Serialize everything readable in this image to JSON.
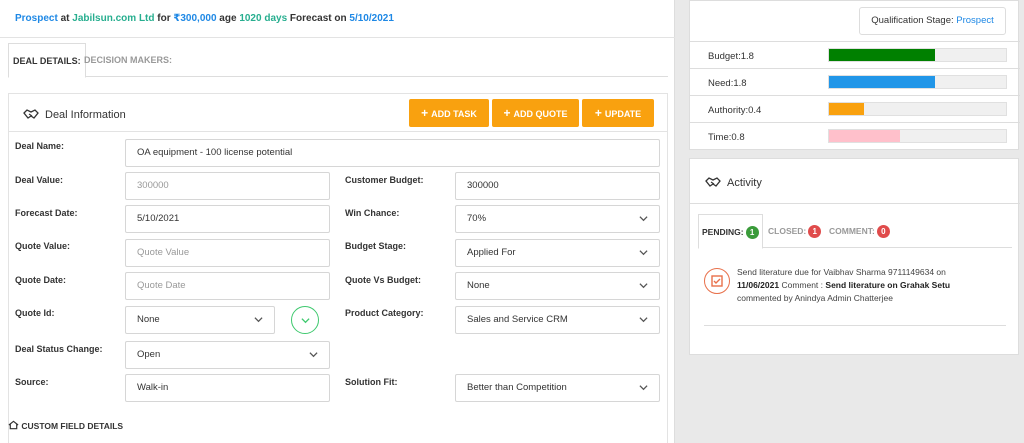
{
  "header": {
    "stage": "Prospect",
    "at": "at",
    "company": "Jabilsun.com Ltd",
    "for": "for",
    "amount": "₹300,000",
    "age_label": "age",
    "age": "1020 days",
    "forecast_label": "Forecast on",
    "forecast_date": "5/10/2021"
  },
  "tabs": {
    "deal_details": "DEAL DETAILS:",
    "decision_makers": "DECISION MAKERS:"
  },
  "deal_info": {
    "title": "Deal Information",
    "buttons": {
      "add_task": "ADD TASK",
      "add_quote": "ADD QUOTE",
      "update": "UPDATE"
    }
  },
  "form": {
    "deal_name": {
      "label": "Deal Name:",
      "value": "OA equipment - 100 license potential"
    },
    "deal_value": {
      "label": "Deal Value:",
      "value": "300000"
    },
    "customer_budget": {
      "label": "Customer Budget:",
      "value": "300000"
    },
    "forecast_date": {
      "label": "Forecast Date:",
      "value": "5/10/2021"
    },
    "win_chance": {
      "label": "Win Chance:",
      "value": "70%"
    },
    "quote_value": {
      "label": "Quote Value:",
      "placeholder": "Quote Value"
    },
    "budget_stage": {
      "label": "Budget Stage:",
      "value": "Applied For"
    },
    "quote_date": {
      "label": "Quote Date:",
      "placeholder": "Quote Date"
    },
    "quote_vs_budget": {
      "label": "Quote Vs Budget:",
      "value": "None"
    },
    "quote_id": {
      "label": "Quote Id:",
      "value": "None"
    },
    "product_category": {
      "label": "Product Category:",
      "value": "Sales and Service CRM"
    },
    "deal_status": {
      "label": "Deal Status Change:",
      "value": "Open"
    },
    "source": {
      "label": "Source:",
      "value": "Walk-in"
    },
    "solution_fit": {
      "label": "Solution Fit:",
      "value": "Better than Competition"
    }
  },
  "custom_field_label": "CUSTOM FIELD DETAILS",
  "qualification": {
    "label": "Qualification Stage:",
    "value": "Prospect",
    "bars": [
      {
        "label": "Budget:1.8",
        "value": 1.8,
        "fraction": 0.6,
        "color": "#008000"
      },
      {
        "label": "Need:1.8",
        "value": 1.8,
        "fraction": 0.6,
        "color": "#2196e8"
      },
      {
        "label": "Authority:0.4",
        "value": 0.4,
        "fraction": 0.2,
        "color": "#f9a10f"
      },
      {
        "label": "Time:0.8",
        "value": 0.8,
        "fraction": 0.4,
        "color": "#ffc0cb"
      }
    ]
  },
  "activity": {
    "title": "Activity",
    "tabs": [
      {
        "label": "PENDING:",
        "count": "1",
        "color": "#3a9b3a"
      },
      {
        "label": "CLOSED:",
        "count": "1",
        "color": "#e04b4b"
      },
      {
        "label": "COMMENT:",
        "count": "0",
        "color": "#e04b4b"
      }
    ],
    "item": {
      "line1": "Send literature due for Vaibhav Sharma 9711149634 on",
      "date": "11/06/2021",
      "comment_label": "Comment :",
      "comment": "Send literature on Grahak Setu",
      "by": "commented by Anindya Admin Chatterjee"
    }
  }
}
